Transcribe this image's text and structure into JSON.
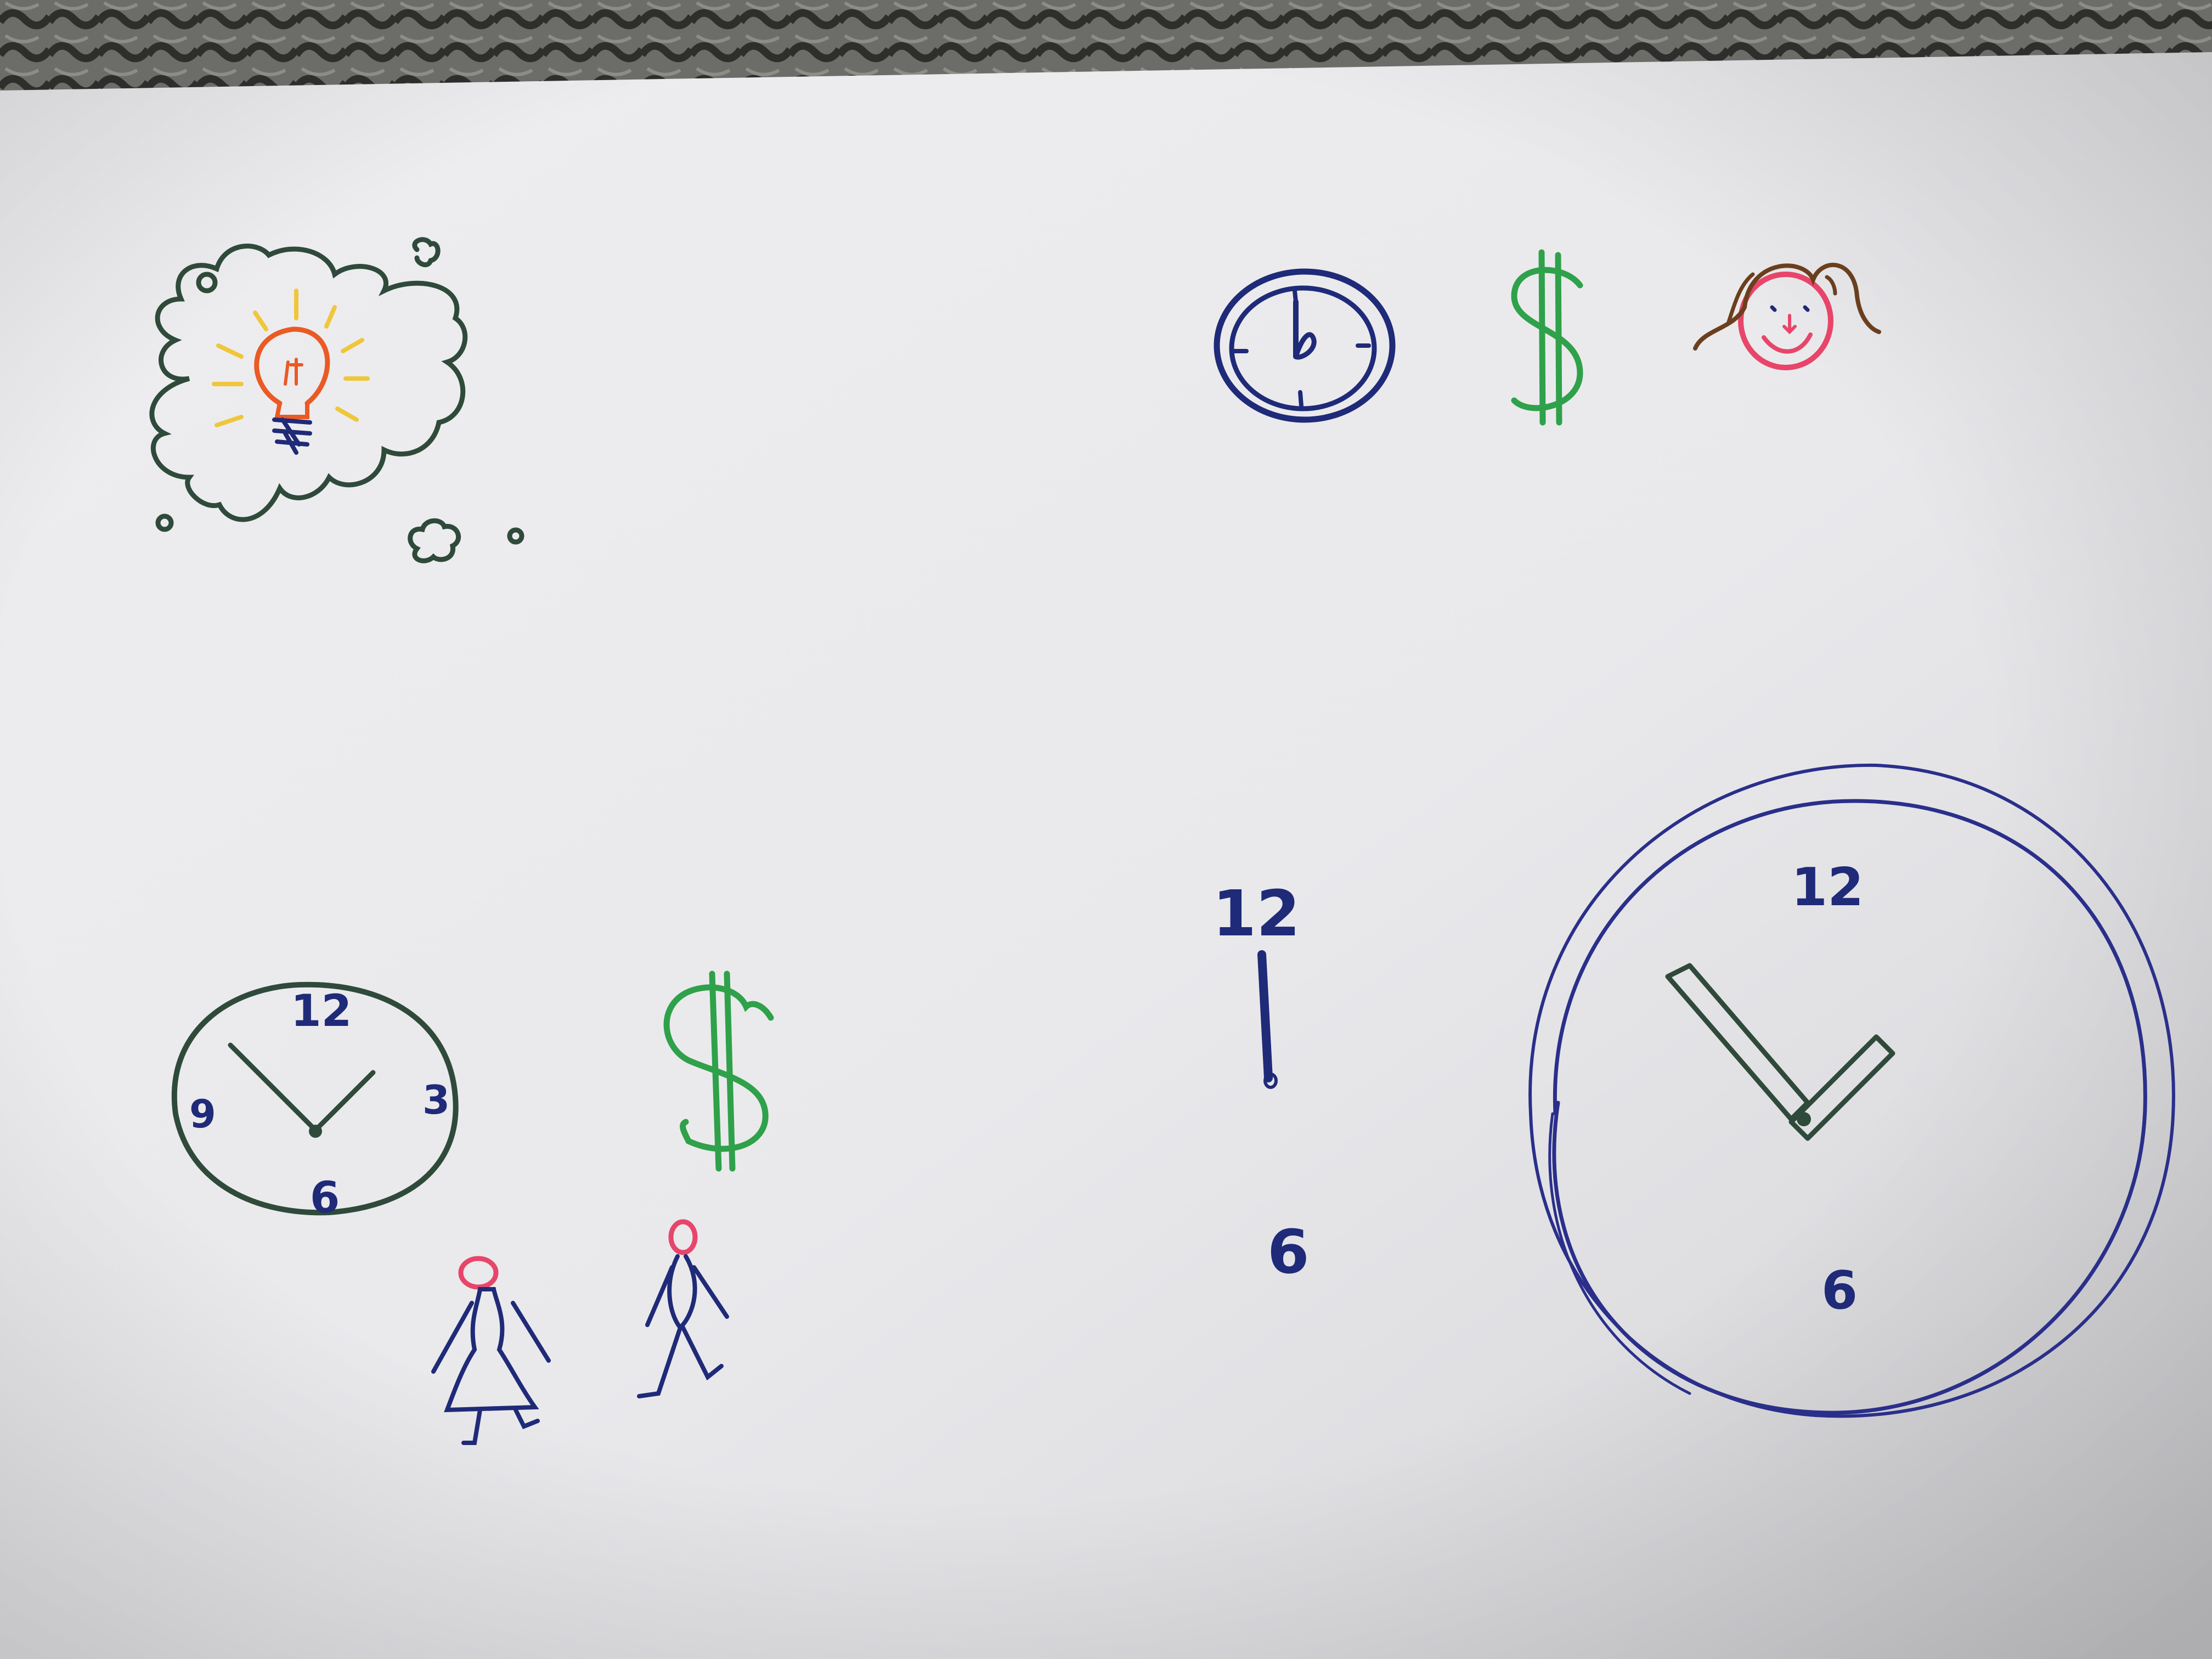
{
  "colors": {
    "carpet": "#5a5a58",
    "paper_light": "#f2f2f4",
    "paper_shadow": "#d9d9dc",
    "navy_ink": "#1f2a78",
    "dark_green_ink": "#2f4a3a",
    "green_ink": "#2fa14a",
    "orange_ink": "#ea5a24",
    "yellow_ink": "#f0c63a",
    "pink_ink": "#e8456a",
    "brown_ink": "#6b3f1e"
  },
  "icons": [
    "idea-thought-cloud-icon",
    "lightbulb-icon",
    "small-clock-icon",
    "dollar-sign-icon",
    "girl-face-icon",
    "analog-clock-icon",
    "stick-figure-woman-icon",
    "stick-figure-man-icon",
    "large-clock-icon"
  ],
  "left_clock": {
    "label_12": "12",
    "label_3": "3",
    "label_6": "6",
    "label_9": "9"
  },
  "middle_dial": {
    "label_12": "12",
    "label_6": "6"
  },
  "large_clock": {
    "label_12": "12",
    "label_6": "6"
  }
}
